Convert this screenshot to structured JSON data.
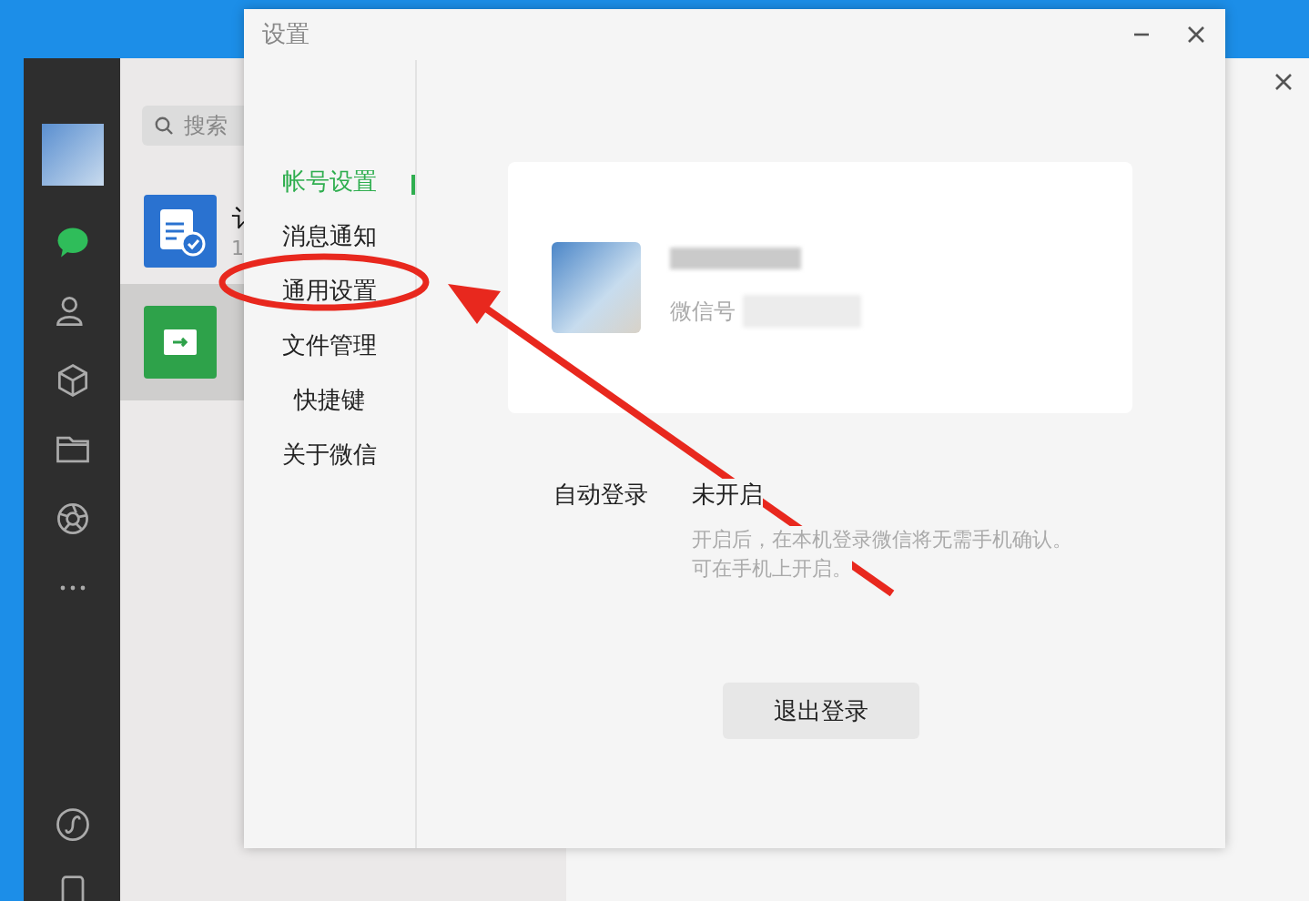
{
  "main_window": {
    "search": {
      "placeholder": "搜索"
    },
    "chats": [
      {
        "title": "讠",
        "subtitle": "1",
        "kind": "doc",
        "selected": false
      },
      {
        "kind": "file",
        "selected": true
      }
    ]
  },
  "settings_dialog": {
    "title": "设置",
    "nav": [
      {
        "label": "帐号设置",
        "selected": true
      },
      {
        "label": "消息通知",
        "selected": false
      },
      {
        "label": "通用设置",
        "selected": false
      },
      {
        "label": "文件管理",
        "selected": false
      },
      {
        "label": "快捷键",
        "selected": false
      },
      {
        "label": "关于微信",
        "selected": false
      }
    ],
    "account": {
      "wechat_id_label": "微信号"
    },
    "auto_login": {
      "label": "自动登录",
      "value": "未开启",
      "hint_lines": [
        "开启后，在本机登录微信将无需手机确认。",
        "可在手机上开启。"
      ]
    },
    "logout_button": "退出登录"
  }
}
